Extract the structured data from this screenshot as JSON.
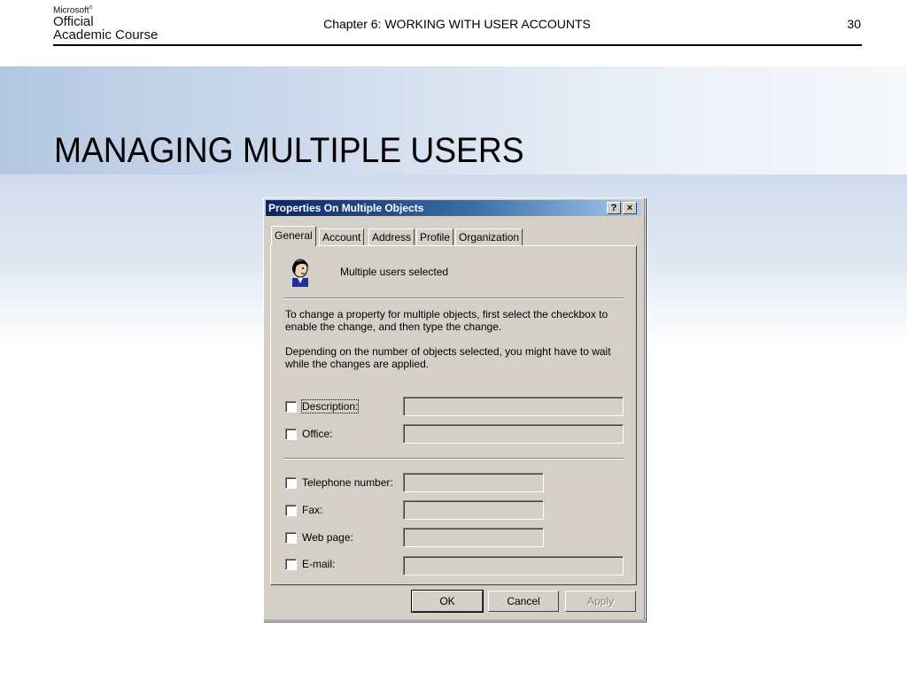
{
  "slide": {
    "logo_microsoft": "Microsoft",
    "logo_official": "Official",
    "logo_course": "Academic Course",
    "header": "Chapter 6: WORKING WITH USER ACCOUNTS",
    "page_number": "30",
    "title": "MANAGING MULTIPLE USERS"
  },
  "dialog": {
    "title": "Properties On Multiple Objects",
    "help_btn": "?",
    "close_btn": "×",
    "tabs": [
      "General",
      "Account",
      "Address",
      "Profile",
      "Organization"
    ],
    "active_tab": "General",
    "icon": "user-icon",
    "selected_label": "Multiple users selected",
    "para1": "To change a property for multiple objects, first select the checkbox to enable the change, and then type the change.",
    "para2": "Depending on the number of objects selected, you might have to wait while the changes are applied.",
    "fields": [
      {
        "label": "Description:",
        "checked": false,
        "value": ""
      },
      {
        "label": "Office:",
        "checked": false,
        "value": ""
      },
      {
        "label": "Telephone number:",
        "checked": false,
        "value": ""
      },
      {
        "label": "Fax:",
        "checked": false,
        "value": ""
      },
      {
        "label": "Web page:",
        "checked": false,
        "value": ""
      },
      {
        "label": "E-mail:",
        "checked": false,
        "value": ""
      }
    ],
    "buttons": {
      "ok": "OK",
      "cancel": "Cancel",
      "apply": "Apply"
    }
  }
}
